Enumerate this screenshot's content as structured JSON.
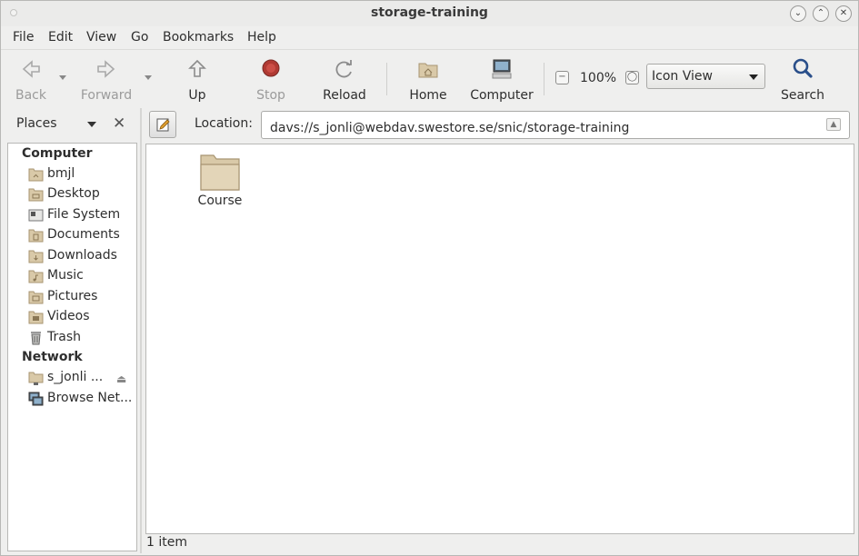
{
  "window": {
    "title": "storage-training"
  },
  "menu": [
    "File",
    "Edit",
    "View",
    "Go",
    "Bookmarks",
    "Help"
  ],
  "toolbar": {
    "back": "Back",
    "forward": "Forward",
    "up": "Up",
    "stop": "Stop",
    "reload": "Reload",
    "home": "Home",
    "computer": "Computer",
    "zoom": "100%",
    "view_mode": "Icon View",
    "search": "Search"
  },
  "sidebar": {
    "header": "Places",
    "sections": {
      "computer": "Computer",
      "network": "Network"
    },
    "computer_items": [
      "bmjl",
      "Desktop",
      "File System",
      "Documents",
      "Downloads",
      "Music",
      "Pictures",
      "Videos",
      "Trash"
    ],
    "network_items": [
      "s_jonli ...",
      "Browse Net..."
    ]
  },
  "location": {
    "label": "Location:",
    "value": "davs://s_jonli@webdav.swestore.se/snic/storage-training"
  },
  "files": [
    {
      "name": "Course",
      "icon": "folder-icon"
    }
  ],
  "status": "1 item",
  "colors": {
    "folder": "#d9c9a8",
    "stop_red": "#c0392b"
  }
}
